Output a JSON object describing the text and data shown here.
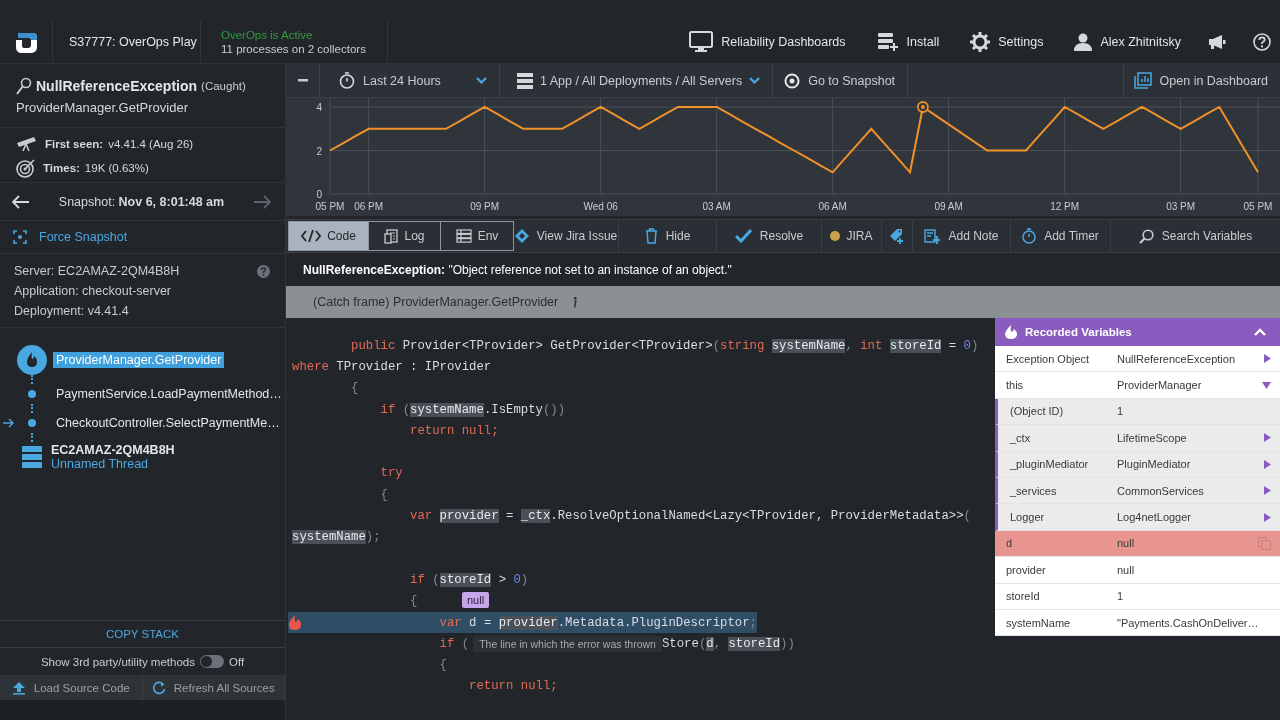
{
  "header": {
    "app_name": "S37777: OverOps Play",
    "status": "OverOps is Active",
    "status_detail": "11 processes on 2 collectors",
    "nav": [
      {
        "kind": "dashboards",
        "label": "Reliability Dashboards"
      },
      {
        "kind": "install",
        "label": "Install"
      },
      {
        "kind": "settings",
        "label": "Settings"
      },
      {
        "kind": "user",
        "label": "Alex Zhitnitsky"
      },
      {
        "kind": "announcements"
      },
      {
        "kind": "help"
      }
    ]
  },
  "sidebar": {
    "exception": "NullReferenceException",
    "caught": "(Caught)",
    "method": "ProviderManager.GetProvider",
    "first_seen_label": "First seen:",
    "first_seen": "v4.41.4  (Aug 26)",
    "times_label": "Times:",
    "times": "19K (0.63%)",
    "snapshot_label": "Snapshot:",
    "snapshot": "Nov 6, 8:01:48 am",
    "force_snapshot": "Force Snapshot",
    "info": [
      "Server: EC2AMAZ-2QM4B8H",
      "Application: checkout-server",
      "Deployment: v4.41.4"
    ],
    "stack": [
      {
        "kind": "error",
        "label": "ProviderManager.GetProvider",
        "selected": true,
        "entry": false
      },
      {
        "kind": "frame",
        "label": "PaymentService.LoadPaymentMethod…",
        "selected": false,
        "entry": false
      },
      {
        "kind": "frame",
        "label": "CheckoutController.SelectPaymentMe…",
        "selected": false,
        "entry": true
      }
    ],
    "thread": {
      "host": "EC2AMAZ-2QM4B8H",
      "name": "Unnamed Thread"
    },
    "copy_stack": "COPY STACK",
    "toggle": {
      "label": "Show 3rd party/utility methods",
      "on": false,
      "state": "Off"
    },
    "bottom_buttons": [
      {
        "kind": "upload",
        "label": "Load Source Code"
      },
      {
        "kind": "refresh",
        "label": "Refresh All Sources"
      }
    ]
  },
  "toolbar": {
    "time_range": "Last 24 Hours",
    "filter": "1 App / All Deployments / All Servers",
    "goto": "Go to Snapshot",
    "open_dashboard": "Open in Dashboard"
  },
  "chart_data": {
    "type": "line",
    "grid": true,
    "categories": [
      "05 PM",
      null,
      null,
      "06 PM",
      null,
      null,
      null,
      null,
      null,
      null,
      null,
      null,
      "09 PM",
      null,
      null,
      null,
      null,
      null,
      null,
      null,
      null,
      "Wed 06",
      null,
      null,
      null,
      null,
      null,
      null,
      null,
      null,
      "03 AM",
      null,
      null,
      null,
      null,
      null,
      null,
      null,
      null,
      "06 AM",
      null,
      null,
      null,
      null,
      null,
      null,
      null,
      null,
      "09 AM",
      null,
      null,
      null,
      null,
      null,
      null,
      null,
      null,
      "12 PM",
      null,
      null,
      null,
      null,
      null,
      null,
      null,
      null,
      "03 PM",
      null,
      null,
      null,
      null,
      null,
      "05 PM"
    ],
    "series": [
      {
        "color": "#f0912a",
        "values": [
          2,
          2.33,
          2.67,
          3,
          3,
          3,
          3,
          3,
          3,
          3,
          3.33,
          3.67,
          4,
          3.67,
          3.33,
          3,
          3,
          3,
          3,
          3.33,
          3.67,
          4,
          3.67,
          3.33,
          3,
          3.33,
          3.67,
          4,
          4,
          4,
          4,
          3.67,
          3.33,
          3,
          2.67,
          2.33,
          2,
          1.67,
          1.33,
          1,
          1.67,
          2.33,
          3,
          2.33,
          1.67,
          1,
          4,
          3.6,
          3.2,
          2.8,
          2.4,
          2,
          2,
          2,
          2,
          2.67,
          3.33,
          4,
          3.67,
          3.33,
          3,
          3.33,
          3.67,
          4,
          3.67,
          3.33,
          3,
          3.33,
          3.67,
          4,
          3,
          2,
          1
        ]
      },
      {
        "color": "#f0912a",
        "marker": "circle",
        "values": [
          null,
          null,
          null,
          null,
          null,
          null,
          null,
          null,
          null,
          null,
          null,
          null,
          null,
          null,
          null,
          null,
          null,
          null,
          null,
          null,
          null,
          null,
          null,
          null,
          null,
          null,
          null,
          null,
          null,
          null,
          null,
          null,
          null,
          null,
          null,
          null,
          null,
          null,
          null,
          null,
          null,
          null,
          null,
          null,
          null,
          null,
          4,
          null,
          null,
          null,
          null,
          null,
          null,
          null,
          null,
          null,
          null,
          null,
          null,
          null,
          null,
          null,
          null,
          null,
          null,
          null,
          null,
          null,
          null,
          null,
          null,
          null,
          null
        ]
      }
    ],
    "ylim": [
      0,
      4
    ],
    "yticks": [
      0,
      2,
      4
    ]
  },
  "view_tabs": [
    {
      "kind": "code",
      "label": "Code",
      "selected": true
    },
    {
      "kind": "log",
      "label": "Log",
      "selected": false
    },
    {
      "kind": "env",
      "label": "Env",
      "selected": false
    }
  ],
  "actions": [
    {
      "kind": "jira-view",
      "label": "View Jira Issue"
    },
    {
      "kind": "hide",
      "label": "Hide"
    },
    {
      "kind": "resolve",
      "label": "Resolve"
    },
    {
      "kind": "jira",
      "label": "JIRA",
      "color": "#c9a24a"
    },
    {
      "kind": "tag"
    },
    {
      "kind": "note",
      "label": "Add Note"
    },
    {
      "kind": "timer",
      "label": "Add Timer"
    },
    {
      "kind": "search",
      "label": "Search Variables"
    }
  ],
  "message": "**NullReferenceException:** \"Object reference not set to an instance of an object.\"",
  "catch_frame": "(Catch frame) ProviderManager.GetProvider",
  "code": [
    {
      "kind": "code",
      "tokens": [
        {
          "t": "        public",
          "kind": "kw"
        },
        {
          "t": " Provider<TProvider> GetProvider<TProvider>",
          "kind": "plain"
        },
        {
          "t": "(",
          "kind": "punct"
        },
        {
          "t": "string ",
          "kind": "kw"
        },
        {
          "t": "systemName",
          "kind": "var"
        },
        {
          "t": ", ",
          "kind": "punct"
        },
        {
          "t": "int ",
          "kind": "kw"
        },
        {
          "t": "storeId",
          "kind": "var"
        },
        {
          "t": " = ",
          "kind": "plain"
        },
        {
          "t": "0",
          "kind": "num"
        },
        {
          "t": ")",
          "kind": "punct"
        }
      ]
    },
    {
      "kind": "code",
      "tokens": [
        {
          "t": "where",
          "kind": "kw"
        },
        {
          "t": " TProvider : IProvider",
          "kind": "plain"
        }
      ]
    },
    {
      "kind": "code",
      "tokens": [
        {
          "t": "        {",
          "kind": "punct"
        }
      ]
    },
    {
      "kind": "code",
      "tokens": [
        {
          "t": "            if",
          "kind": "kw"
        },
        {
          "t": " (",
          "kind": "punct"
        },
        {
          "t": "systemName",
          "kind": "var"
        },
        {
          "t": ".IsEmpty",
          "kind": "plain"
        },
        {
          "t": "())",
          "kind": "punct"
        }
      ]
    },
    {
      "kind": "code",
      "tokens": [
        {
          "t": "                return null;",
          "kind": "kw"
        }
      ]
    },
    {
      "kind": "blank"
    },
    {
      "kind": "code",
      "tokens": [
        {
          "t": "            try",
          "kind": "kw"
        }
      ]
    },
    {
      "kind": "code",
      "tokens": [
        {
          "t": "            {",
          "kind": "punct"
        }
      ]
    },
    {
      "kind": "code",
      "tokens": [
        {
          "t": "                var ",
          "kind": "kw"
        },
        {
          "t": "provider",
          "kind": "var"
        },
        {
          "t": " = ",
          "kind": "plain"
        },
        {
          "t": "_ctx",
          "kind": "var"
        },
        {
          "t": ".ResolveOptionalNamed<Lazy<TProvider, ProviderMetadata>>",
          "kind": "plain"
        },
        {
          "t": "(",
          "kind": "punct"
        }
      ]
    },
    {
      "kind": "code",
      "tokens": [
        {
          "t": "systemName",
          "kind": "var"
        },
        {
          "t": ");",
          "kind": "punct"
        }
      ]
    },
    {
      "kind": "blank"
    },
    {
      "kind": "code",
      "tokens": [
        {
          "t": "                if",
          "kind": "kw"
        },
        {
          "t": " (",
          "kind": "punct"
        },
        {
          "t": "storeId",
          "kind": "var"
        },
        {
          "t": " > ",
          "kind": "plain"
        },
        {
          "t": "0",
          "kind": "num"
        },
        {
          "t": ")",
          "kind": "punct"
        }
      ]
    },
    {
      "kind": "code",
      "tokens": [
        {
          "t": "                {",
          "kind": "punct"
        }
      ],
      "value_hint": "null"
    },
    {
      "kind": "code",
      "error": true,
      "tokens": [
        {
          "t": "                    var ",
          "kind": "kw"
        },
        {
          "t": "d",
          "kind": "plain"
        },
        {
          "t": " = ",
          "kind": "plain"
        },
        {
          "t": "provider",
          "kind": "var"
        },
        {
          "t": ".Metadata.PluginDescriptor",
          "kind": "plain"
        },
        {
          "t": ";",
          "kind": "punct"
        }
      ]
    },
    {
      "kind": "code",
      "error": false,
      "tokens": [
        {
          "t": "                    if",
          "kind": "kw"
        },
        {
          "t": " (",
          "kind": "punct"
        }
      ],
      "tooltip": "The line in which the error was thrown",
      "tokens_after": [
        {
          "t": "Store",
          "kind": "plain"
        },
        {
          "t": "(",
          "kind": "punct"
        },
        {
          "t": "d",
          "kind": "var"
        },
        {
          "t": ", ",
          "kind": "punct"
        },
        {
          "t": "storeId",
          "kind": "var"
        },
        {
          "t": "))",
          "kind": "punct"
        }
      ]
    },
    {
      "kind": "code",
      "tokens": [
        {
          "t": "                    {",
          "kind": "punct"
        }
      ]
    },
    {
      "kind": "code",
      "tokens": [
        {
          "t": "                        return null;",
          "kind": "kw"
        }
      ]
    }
  ],
  "variables": {
    "title": "Recorded Variables",
    "expanded": true,
    "rows": [
      {
        "name": "Exception Object",
        "value": "NullReferenceException",
        "kind": "object",
        "expanded": false
      },
      {
        "name": "this",
        "value": "ProviderManager",
        "kind": "object",
        "expanded": true,
        "children": [
          {
            "name": "(Object ID)",
            "value": "1",
            "kind": "primitive"
          },
          {
            "name": "_ctx",
            "value": "LifetimeScope",
            "kind": "object",
            "expanded": false
          },
          {
            "name": "_pluginMediator",
            "value": "PluginMediator",
            "kind": "object",
            "expanded": false
          },
          {
            "name": "_services",
            "value": "CommonServices",
            "kind": "object",
            "expanded": false
          },
          {
            "name": "Logger",
            "value": "Log4netLogger",
            "kind": "object",
            "expanded": false
          }
        ]
      },
      {
        "name": "d",
        "value": "null",
        "kind": "primitive",
        "error": true
      },
      {
        "name": "provider",
        "value": "null",
        "kind": "primitive",
        "error": false
      },
      {
        "name": "storeId",
        "value": "1",
        "kind": "primitive",
        "error": false
      },
      {
        "name": "systemName",
        "value": "\"Payments.CashOnDeliver…",
        "kind": "primitive",
        "error": false
      }
    ]
  }
}
